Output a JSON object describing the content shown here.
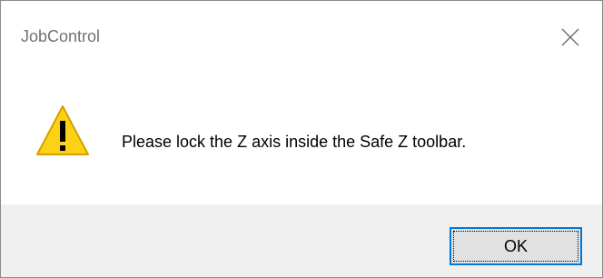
{
  "window": {
    "title": "JobControl",
    "close_icon": "close-icon"
  },
  "content": {
    "icon": "warning-icon",
    "message": "Please lock the Z axis inside the Safe Z toolbar."
  },
  "footer": {
    "ok_label": "OK"
  },
  "colors": {
    "title_text": "#737373",
    "footer_bg": "#f0f0f0",
    "button_bg": "#e1e1e1",
    "button_focus_border": "#0078d7",
    "warning_fill": "#fcd116",
    "warning_stroke": "#d4a000"
  }
}
